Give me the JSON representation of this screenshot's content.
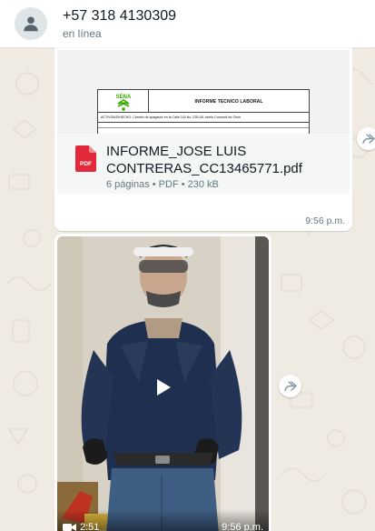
{
  "header": {
    "contact_name": "+57 318 4130309",
    "status": "en línea",
    "avatar_icon": "person-icon"
  },
  "document_message": {
    "preview": {
      "logo_text": "SENA",
      "heading": "INFORME TECNICO LABORAL",
      "activity_line": "ACTIVIDAD/HECHO: Cambio de apagador en la Calle 11A No. 22B-08, barrio Concordi de Girón"
    },
    "file_type_badge": "PDF",
    "file_name": "INFORME_JOSE LUIS CONTRERAS_CC13465771.pdf",
    "file_meta": "6 páginas • PDF • 230 kB",
    "time": "9:56 p.m."
  },
  "video_message": {
    "duration": "2:51",
    "time": "9:56 p.m.",
    "play_icon": "play-icon",
    "duration_icon": "video-camera-icon"
  },
  "colors": {
    "chat_background": "#efeae2",
    "bubble": "#ffffff",
    "pdf_red": "#e2293a",
    "secondary_text": "#667781",
    "sena_green": "#39a900"
  }
}
